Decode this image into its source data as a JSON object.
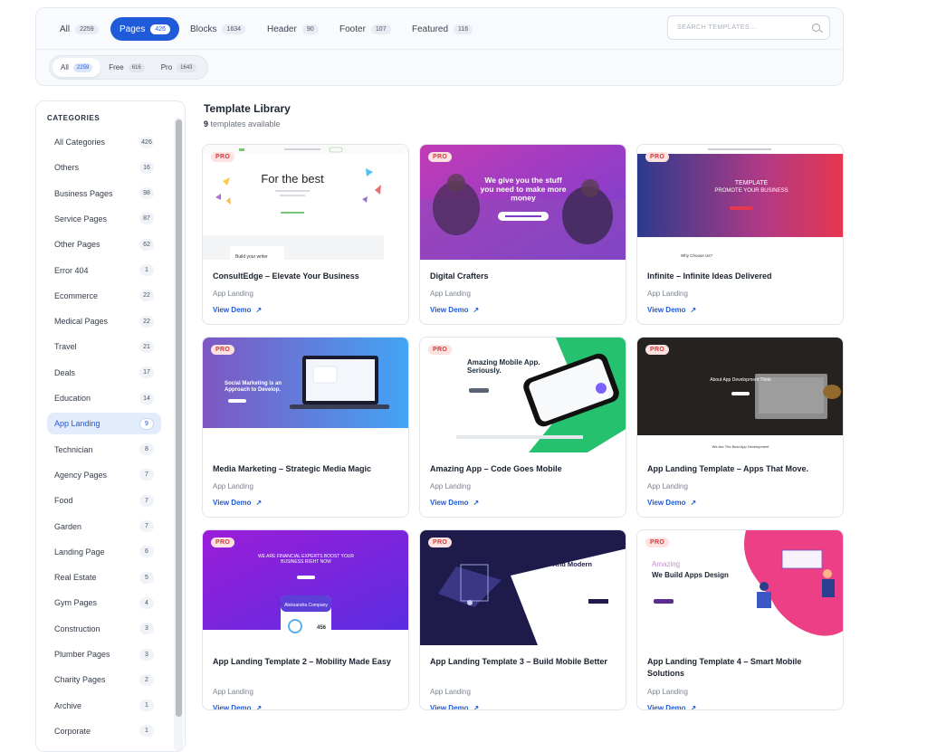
{
  "filters": {
    "tabs": [
      {
        "label": "All",
        "count": "2259"
      },
      {
        "label": "Pages",
        "count": "426"
      },
      {
        "label": "Blocks",
        "count": "1634"
      },
      {
        "label": "Header",
        "count": "90"
      },
      {
        "label": "Footer",
        "count": "107"
      },
      {
        "label": "Featured",
        "count": "116"
      }
    ],
    "active_tab": "Pages",
    "search_placeholder": "SEARCH TEMPLATES...",
    "pricing": [
      {
        "label": "All",
        "count": "2259"
      },
      {
        "label": "Free",
        "count": "616"
      },
      {
        "label": "Pro",
        "count": "1643"
      }
    ],
    "active_pricing": "All"
  },
  "sidebar": {
    "heading": "CATEGORIES",
    "active": "App Landing",
    "items": [
      {
        "label": "All Categories",
        "count": "426"
      },
      {
        "label": "Others",
        "count": "16"
      },
      {
        "label": "Business Pages",
        "count": "98"
      },
      {
        "label": "Service Pages",
        "count": "87"
      },
      {
        "label": "Other Pages",
        "count": "62"
      },
      {
        "label": "Error 404",
        "count": "1"
      },
      {
        "label": "Ecommerce",
        "count": "22"
      },
      {
        "label": "Medical Pages",
        "count": "22"
      },
      {
        "label": "Travel",
        "count": "21"
      },
      {
        "label": "Deals",
        "count": "17"
      },
      {
        "label": "Education",
        "count": "14"
      },
      {
        "label": "App Landing",
        "count": "9"
      },
      {
        "label": "Technician",
        "count": "8"
      },
      {
        "label": "Agency Pages",
        "count": "7"
      },
      {
        "label": "Food",
        "count": "7"
      },
      {
        "label": "Garden",
        "count": "7"
      },
      {
        "label": "Landing Page",
        "count": "6"
      },
      {
        "label": "Real Estate",
        "count": "5"
      },
      {
        "label": "Gym Pages",
        "count": "4"
      },
      {
        "label": "Construction",
        "count": "3"
      },
      {
        "label": "Plumber Pages",
        "count": "3"
      },
      {
        "label": "Charity Pages",
        "count": "2"
      },
      {
        "label": "Archive",
        "count": "1"
      },
      {
        "label": "Corporate",
        "count": "1"
      }
    ]
  },
  "library": {
    "title": "Template Library",
    "count": "9",
    "count_suffix": " templates available",
    "badge": "PRO",
    "view_demo": "View Demo",
    "arrow": "↗",
    "cards": [
      {
        "title": "ConsultEdge – Elevate Your Business",
        "category": "App Landing",
        "thumb_text": "For the best",
        "thumb_sub": "Build your writer"
      },
      {
        "title": "Digital Crafters",
        "category": "App Landing",
        "thumb_text": "We give you the stuff you need to make more money"
      },
      {
        "title": "Infinite – Infinite Ideas Delivered",
        "category": "App Landing",
        "thumb_text": "TEMPLATE",
        "thumb_sub": "PROMOTE YOUR BUSINESS",
        "thumb_note": "Why Choose Us?"
      },
      {
        "title": "Media Marketing – Strategic Media Magic",
        "category": "App Landing",
        "thumb_text": "Social Marketing is an Approach to Develop."
      },
      {
        "title": "Amazing App – Code Goes Mobile",
        "category": "App Landing",
        "thumb_text": "Amazing Mobile App. Seriously."
      },
      {
        "title": "App Landing Template – Apps That Move.",
        "category": "App Landing",
        "thumb_text": "About App Development Think",
        "thumb_note": "We Are The Best App Development"
      },
      {
        "title": "App Landing Template 2 – Mobility Made Easy",
        "category": "App Landing",
        "thumb_text": "WE ARE FINANCIAL EXPERTS BOOST YOUR BUSINESS RIGHT NOW",
        "thumb_sub": "Aleksandra Company",
        "thumb_num": "456"
      },
      {
        "title": "App Landing Template 3 – Build Mobile Better",
        "category": "App Landing",
        "thumb_text": "Templa Creative And Modern"
      },
      {
        "title": "App Landing Template 4 – Smart Mobile Solutions",
        "category": "App Landing",
        "thumb_text": "Amazing",
        "thumb_sub": "We Build Apps Design"
      }
    ]
  },
  "colors": {
    "accent": "#1f5ad8",
    "pro_bg": "#fde2e2",
    "pro_text": "#d23b3b"
  }
}
